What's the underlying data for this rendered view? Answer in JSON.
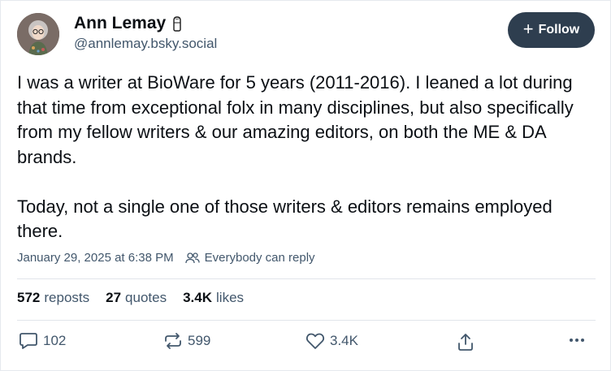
{
  "author": {
    "display_name": "Ann Lemay",
    "handle": "@annlemay.bsky.social",
    "avatar_icon": "avatar-illustration",
    "name_badge_icon": "salt-shaker-icon"
  },
  "follow_button": {
    "icon": "plus",
    "label": "Follow"
  },
  "post": {
    "text": "I was a writer at BioWare for 5 years (2011-2016). I leaned a lot during that time from exceptional folx in many disciplines, but also specifically from my fellow writers & our amazing editors, on both the ME & DA brands.\n\nToday, not a single one of those writers & editors remains employed there.",
    "timestamp": "January 29, 2025 at 6:38 PM",
    "reply_setting": "Everybody can reply"
  },
  "stats": {
    "reposts_count": "572",
    "reposts_label": "reposts",
    "quotes_count": "27",
    "quotes_label": "quotes",
    "likes_count": "3.4K",
    "likes_label": "likes"
  },
  "actions": {
    "reply_count": "102",
    "repost_count": "599",
    "like_count": "3.4K"
  },
  "colors": {
    "follow_bg": "#2e3e4f",
    "muted_text": "#42576c",
    "divider": "#e1e5ea"
  }
}
